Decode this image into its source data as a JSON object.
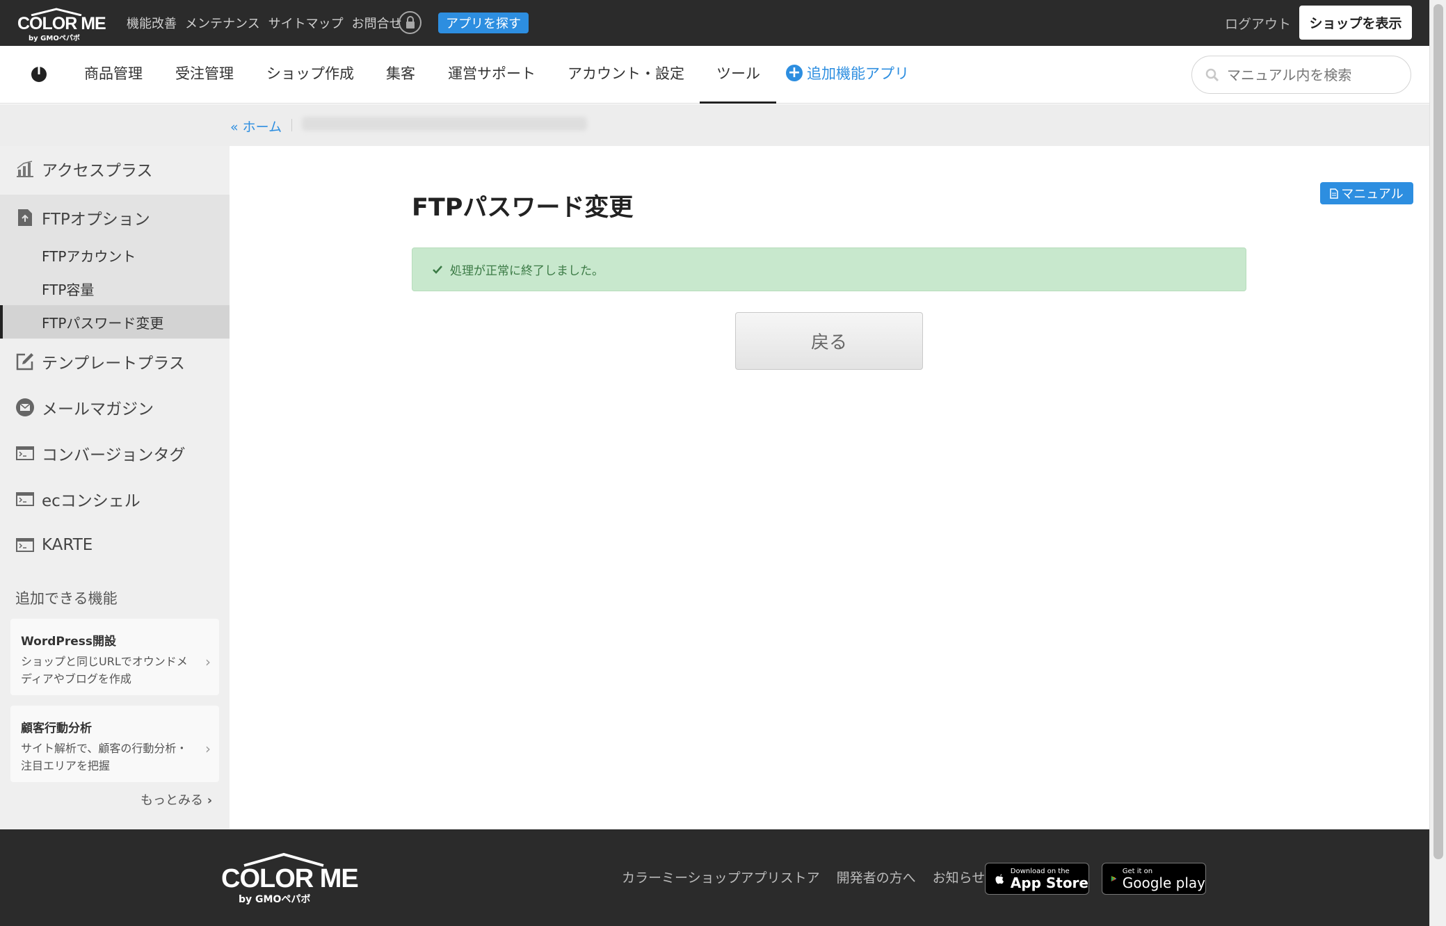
{
  "topbar": {
    "logo": "COLOR ME",
    "logo_sub": "by GMOペパボ",
    "links": [
      "機能改善",
      "メンテナンス",
      "サイトマップ",
      "お問合せ"
    ],
    "app_find_label": "アプリを探す",
    "logout_label": "ログアウト",
    "show_shop_label": "ショップを表示"
  },
  "nav": {
    "items": [
      "商品管理",
      "受注管理",
      "ショップ作成",
      "集客",
      "運営サポート",
      "アカウント・設定",
      "ツール"
    ],
    "active": "ツール",
    "addon_label": "追加機能アプリ",
    "search_placeholder": "マニュアル内を検索"
  },
  "breadcrumb": {
    "home": "« ホーム"
  },
  "sidebar": {
    "items": [
      {
        "label": "アクセスプラス",
        "icon": "bar-chart-icon"
      },
      {
        "label": "FTPオプション",
        "icon": "upload-file-icon"
      },
      {
        "label": "テンプレートプラス",
        "icon": "edit-icon"
      },
      {
        "label": "メールマガジン",
        "icon": "mail-icon"
      },
      {
        "label": "コンバージョンタグ",
        "icon": "terminal-icon"
      },
      {
        "label": "ecコンシェル",
        "icon": "terminal-icon"
      },
      {
        "label": "KARTE",
        "icon": "terminal-icon"
      }
    ],
    "sub_items": [
      "FTPアカウント",
      "FTP容量",
      "FTPパスワード変更"
    ],
    "active_sub": "FTPパスワード変更",
    "section_title": "追加できる機能",
    "promos": [
      {
        "title": "WordPress開設",
        "desc": "ショップと同じURLでオウンドメディアやブログを作成"
      },
      {
        "title": "顧客行動分析",
        "desc": "サイト解析で、顧客の行動分析・注目エリアを把握"
      }
    ],
    "more_label": "もっとみる"
  },
  "main": {
    "title": "FTPパスワード変更",
    "manual_label": "マニュアル",
    "alert": "処理が正常に終了しました。",
    "back_label": "戻る"
  },
  "footer": {
    "logo": "COLOR ME",
    "logo_sub": "by GMOペパボ",
    "links": [
      "カラーミーショップアプリストア",
      "開発者の方へ",
      "お知らせ"
    ],
    "app_store_small": "Download on the",
    "app_store_big": "App Store",
    "google_small": "Get it on",
    "google_big": "Google play"
  },
  "colors": {
    "accent": "#2d8ee0",
    "topbar_bg": "#2b2b2b",
    "success_bg": "#c8e8cd",
    "sidebar_bg": "#efefef"
  }
}
